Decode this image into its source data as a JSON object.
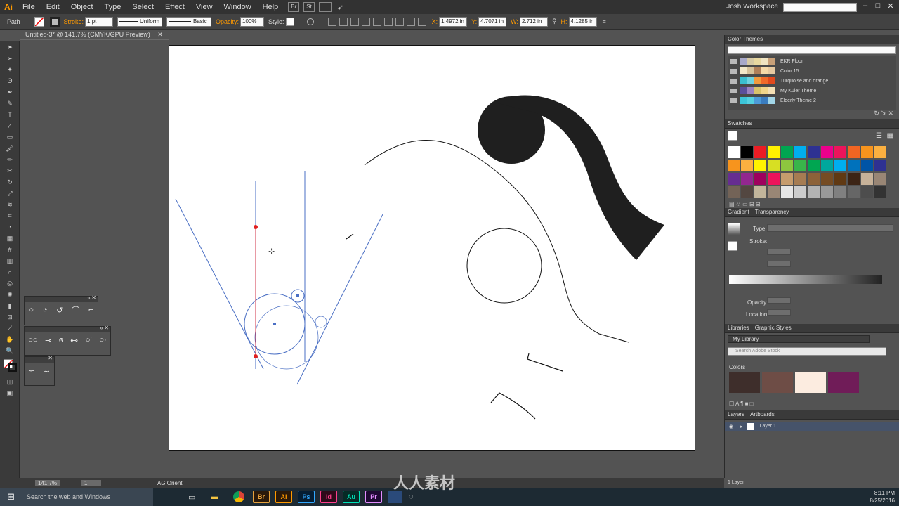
{
  "app": {
    "logo": "Ai"
  },
  "menu": [
    "File",
    "Edit",
    "Object",
    "Type",
    "Select",
    "Effect",
    "View",
    "Window",
    "Help"
  ],
  "menu_badges": [
    "Br",
    "St"
  ],
  "workspace": "Josh Workspace",
  "control": {
    "selection": "Path",
    "stroke_label": "Stroke:",
    "stroke_weight": "1 pt",
    "profile": "Uniform",
    "brush": "Basic",
    "opacity_label": "Opacity:",
    "opacity": "100%",
    "style_label": "Style:",
    "x_label": "X:",
    "x": "1.4972 in",
    "y_label": "Y:",
    "y": "4.7071 in",
    "w_label": "W:",
    "w": "2.712 in",
    "h_label": "H:",
    "h": "4.1285 in"
  },
  "doc_tab": "Untitled-3* @ 141.7% (CMYK/GPU Preview)",
  "panels": {
    "color_themes": {
      "title": "Color Themes",
      "themes": [
        {
          "name": "EKR Floor",
          "colors": [
            "#a8a9c9",
            "#d6c9a4",
            "#e8d8a0",
            "#f0e4c2",
            "#c8a078"
          ]
        },
        {
          "name": "Color 15",
          "colors": [
            "#f3e8c8",
            "#d7c29a",
            "#b0805a",
            "#f5d9a8",
            "#e6c9a0"
          ]
        },
        {
          "name": "Turquoise and orange",
          "colors": [
            "#3bbfcf",
            "#6fd3e0",
            "#f29a3d",
            "#f06a2a",
            "#e24a1d"
          ]
        },
        {
          "name": "My Kuler Theme",
          "colors": [
            "#5a4f9a",
            "#9b82c0",
            "#d9c26a",
            "#f1d58a",
            "#f4e0b5"
          ]
        },
        {
          "name": "Elderly Theme 2",
          "colors": [
            "#3cc4d8",
            "#55d0e0",
            "#4d9bd8",
            "#3a7dc0",
            "#a2d6e8"
          ]
        }
      ]
    },
    "swatches": {
      "title": "Swatches",
      "colors": [
        "#ffffff",
        "#000000",
        "#ed1c24",
        "#fff200",
        "#00a651",
        "#00aeef",
        "#2e3192",
        "#ec008c",
        "#ed145b",
        "#f26522",
        "#f7941d",
        "#fbb040",
        "#f7941d",
        "#fbb040",
        "#fff200",
        "#d7df23",
        "#8dc63f",
        "#39b54a",
        "#00a651",
        "#00a79d",
        "#00aeef",
        "#0072bc",
        "#0054a6",
        "#2e3192",
        "#662d91",
        "#92278f",
        "#9e005d",
        "#ed145b",
        "#c69c6d",
        "#a67c52",
        "#8c6239",
        "#754c24",
        "#603913",
        "#3c2415",
        "#c7b299",
        "#998675",
        "#736357",
        "#534741",
        "#c2b59b",
        "#998675",
        "#e6e6e6",
        "#cccccc",
        "#b3b3b3",
        "#999999",
        "#808080",
        "#666666",
        "#4d4d4d",
        "#333333"
      ]
    },
    "gradient": {
      "tabs": [
        "Gradient",
        "Transparency"
      ],
      "type_label": "Type:",
      "stroke_label": "Stroke:",
      "opacity_label": "Opacity:",
      "location_label": "Location:"
    },
    "libraries": {
      "tabs": [
        "Libraries",
        "Graphic Styles"
      ],
      "library": "My Library",
      "search_placeholder": "Search Adobe Stock",
      "colors_label": "Colors",
      "colors": [
        "#3e2e2b",
        "#6e4d46",
        "#fcece0",
        "#701c58"
      ]
    },
    "layers": {
      "tabs": [
        "Layers",
        "Artboards"
      ],
      "layer": "Layer 1",
      "count": "1 Layer"
    }
  },
  "status": {
    "zoom": "141.7%",
    "artboard": "1",
    "tool": "AG Orient"
  },
  "taskbar": {
    "search": "Search the web and Windows",
    "apps": [
      {
        "label": "Br",
        "bg": "#2b1a0a",
        "fg": "#e8a33d"
      },
      {
        "label": "Ai",
        "bg": "#2b1a0a",
        "fg": "#ff9a00"
      },
      {
        "label": "Ps",
        "bg": "#061e33",
        "fg": "#31a8ff"
      },
      {
        "label": "Id",
        "bg": "#2e0a1a",
        "fg": "#ff3f8e"
      },
      {
        "label": "Au",
        "bg": "#062a26",
        "fg": "#00e4bb"
      },
      {
        "label": "Pr",
        "bg": "#1f0a33",
        "fg": "#e38dff"
      }
    ],
    "time": "8:11 PM",
    "date": "8/25/2016"
  },
  "watermark": "人人素材"
}
